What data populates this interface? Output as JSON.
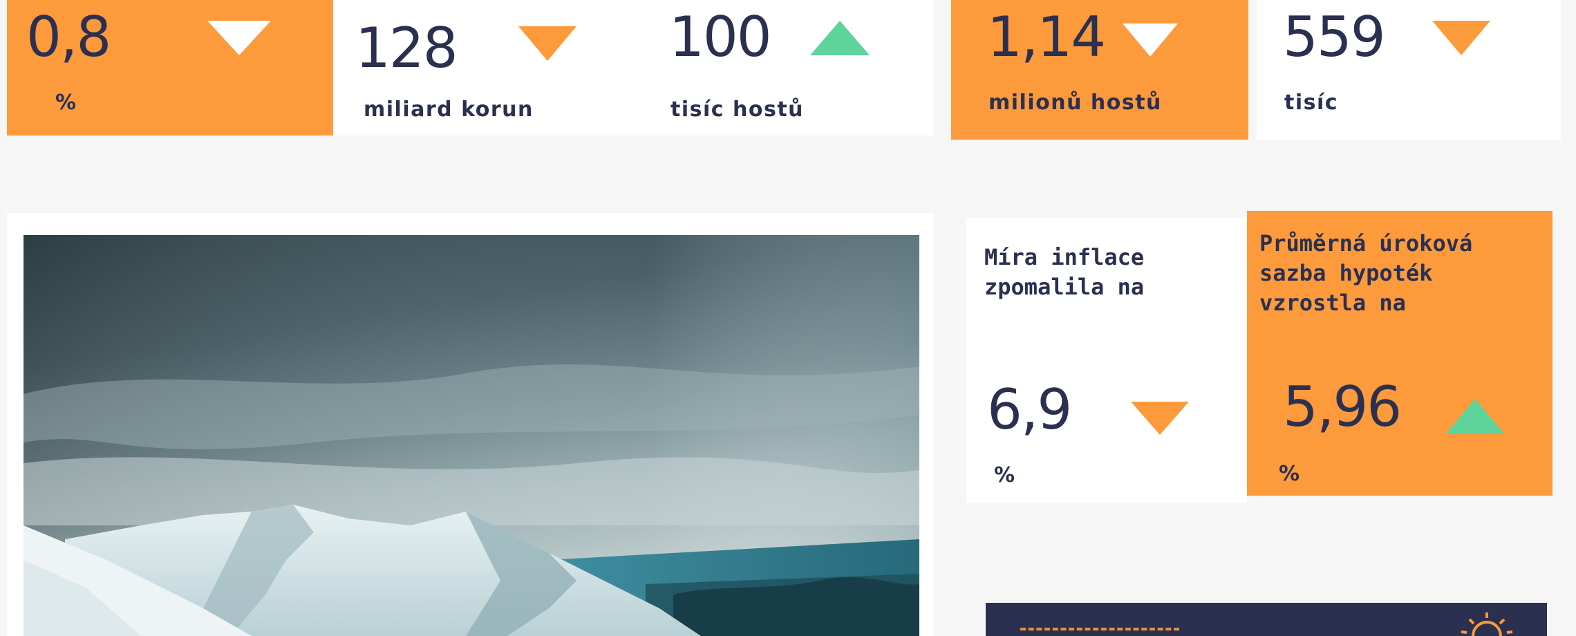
{
  "colors": {
    "orange": "#fd9a3c",
    "navy": "#2b3050",
    "white": "#ffffff",
    "green": "#5ed39a",
    "background": "#f6f6f6"
  },
  "stats_top": [
    {
      "value": "0,8",
      "unit": "%",
      "trend": "down",
      "trend_icon": "triangle-down-white-icon"
    },
    {
      "value": "128",
      "unit": "miliard korun",
      "trend": "down",
      "trend_icon": "triangle-down-orange-icon"
    },
    {
      "value": "100",
      "unit": "tisíc hostů",
      "trend": "up",
      "trend_icon": "triangle-up-green-icon"
    },
    {
      "value": "1,14",
      "unit": "milionů hostů",
      "trend": "down",
      "trend_icon": "triangle-down-white-icon"
    },
    {
      "value": "559",
      "unit": "tisíc",
      "trend": "down",
      "trend_icon": "triangle-down-orange-icon"
    }
  ],
  "inflation": {
    "heading": "Míra inflace zpomalila na",
    "value": "6,9",
    "unit": "%",
    "trend": "down",
    "trend_icon": "triangle-down-orange-icon"
  },
  "mortgage": {
    "heading": "Průměrná úroková sazba hypoték vzrostla na",
    "value": "5,96",
    "unit": "%",
    "trend": "up",
    "trend_icon": "triangle-up-green-icon"
  },
  "article_image": {
    "description": "snowy-mountains-photo"
  },
  "banner": {
    "icon": "sun-icon"
  }
}
